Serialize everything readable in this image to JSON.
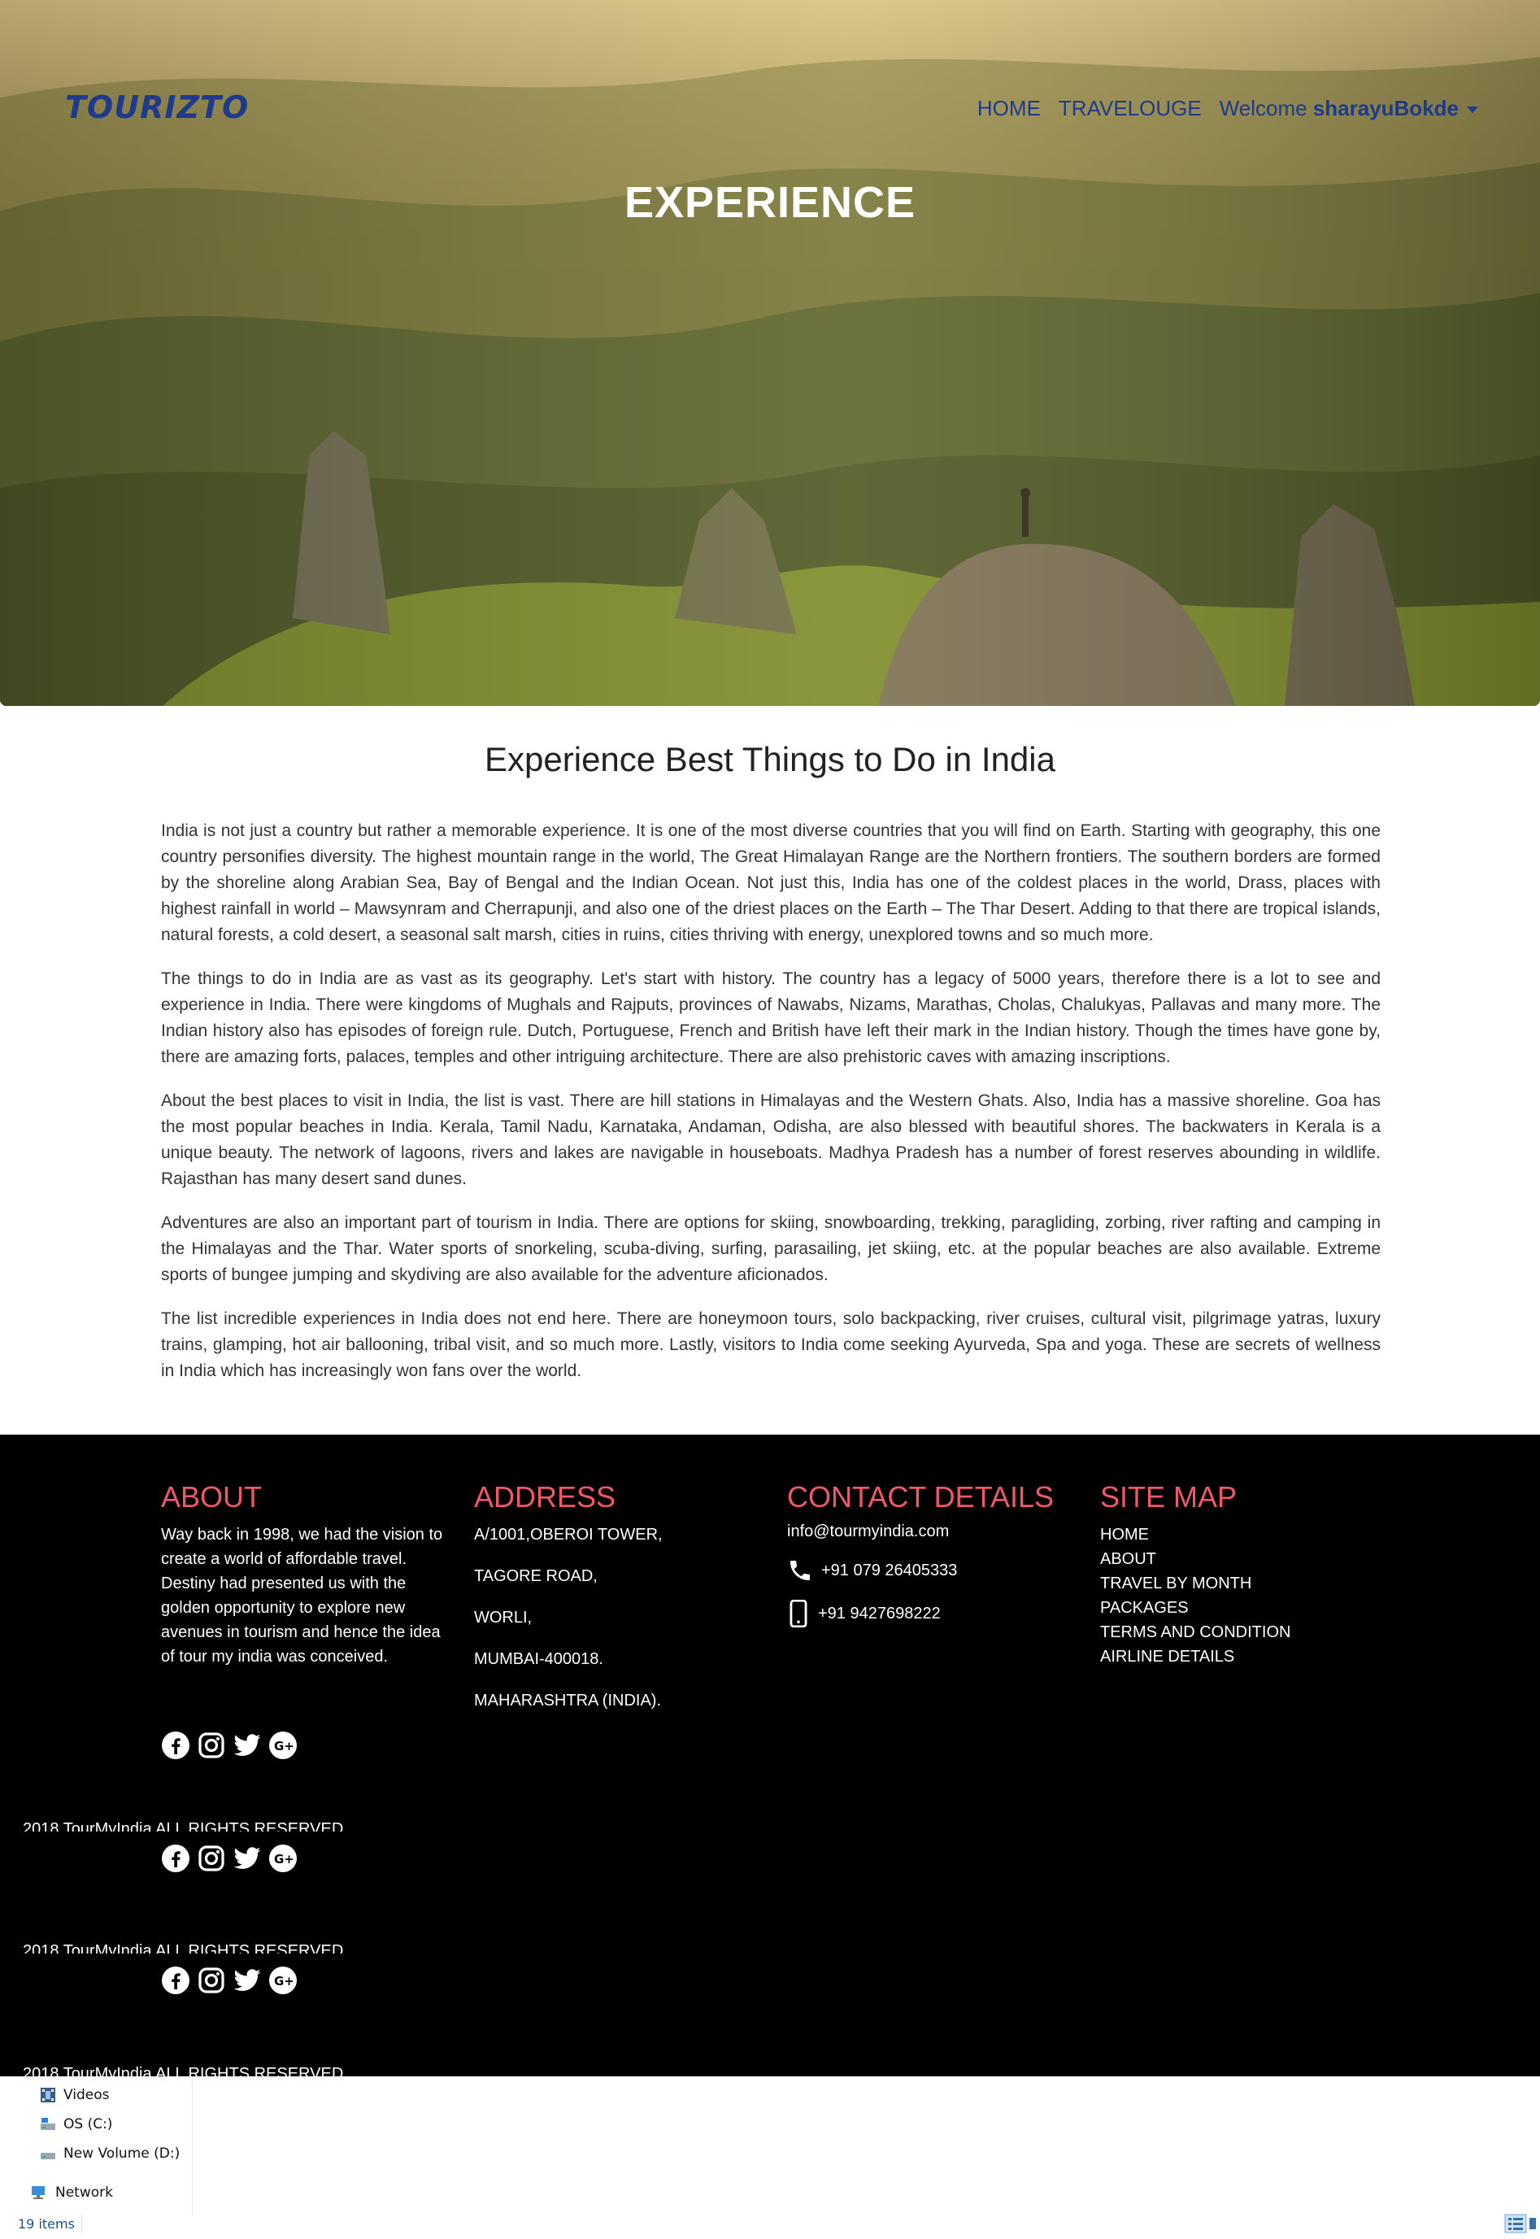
{
  "brand": {
    "logo": "TOURIZTO"
  },
  "nav": {
    "home": "HOME",
    "travelouge": "TRAVELOUGE",
    "welcome": "Welcome",
    "user": "sharayuBokde"
  },
  "hero": {
    "title": "EXPERIENCE"
  },
  "content": {
    "title": "Experience Best Things to Do in India",
    "paragraphs": [
      "India is not just a country but rather a memorable experience. It is one of the most diverse countries that you will find on Earth. Starting with geography, this one country personifies diversity. The highest mountain range in the world, The Great Himalayan Range are the Northern frontiers. The southern borders are formed by the shoreline along Arabian Sea, Bay of Bengal and the Indian Ocean. Not just this, India has one of the coldest places in the world, Drass, places with highest rainfall in world – Mawsynram and Cherrapunji, and also one of the driest places on the Earth – The Thar Desert. Adding to that there are tropical islands, natural forests, a cold desert, a seasonal salt marsh, cities in ruins, cities thriving with energy, unexplored towns and so much more.",
      "The things to do in India are as vast as its geography. Let's start with history. The country has a legacy of 5000 years, therefore there is a lot to see and experience in India. There were kingdoms of Mughals and Rajputs, provinces of Nawabs, Nizams, Marathas, Cholas, Chalukyas, Pallavas and many more. The Indian history also has episodes of foreign rule. Dutch, Portuguese, French and British have left their mark in the Indian history. Though the times have gone by, there are amazing forts, palaces, temples and other intriguing architecture. There are also prehistoric caves with amazing inscriptions.",
      "About the best places to visit in India, the list is vast. There are hill stations in Himalayas and the Western Ghats. Also, India has a massive shoreline. Goa has the most popular beaches in India. Kerala, Tamil Nadu, Karnataka, Andaman, Odisha, are also blessed with beautiful shores. The backwaters in Kerala is a unique beauty. The network of lagoons, rivers and lakes are navigable in houseboats. Madhya Pradesh has a number of forest reserves abounding in wildlife. Rajasthan has many desert sand dunes.",
      "Adventures are also an important part of tourism in India. There are options for skiing, snowboarding, trekking, paragliding, zorbing, river rafting and camping in the Himalayas and the Thar. Water sports of snorkeling, scuba-diving, surfing, parasailing, jet skiing, etc. at the popular beaches are also available. Extreme sports of bungee jumping and skydiving are also available for the adventure aficionados.",
      "The list incredible experiences in India does not end here. There are honeymoon tours, solo backpacking, river cruises, cultural visit, pilgrimage yatras, luxury trains, glamping, hot air ballooning, tribal visit, and so much more. Lastly, visitors to India come seeking Ayurveda, Spa and yoga. These are secrets of wellness in India which has increasingly won fans over the world."
    ]
  },
  "footer": {
    "about": {
      "heading": "ABOUT",
      "text": "Way back in 1998, we had the vision to create a world of affordable travel. Destiny had presented us with the golden opportunity to explore new avenues in tourism and hence the idea of tour my india was conceived."
    },
    "address": {
      "heading": "ADDRESS",
      "lines": [
        "A/1001,OBEROI TOWER,",
        "TAGORE ROAD,",
        "WORLI,",
        "MUMBAI-400018.",
        "MAHARASHTRA (INDIA)."
      ]
    },
    "contact": {
      "heading": "CONTACT DETAILS",
      "email": "info@tourmyindia.com",
      "phone": "+91 079 26405333",
      "mobile": "+91 9427698222"
    },
    "sitemap": {
      "heading": "SITE MAP",
      "links": [
        "HOME",
        "ABOUT",
        "TRAVEL BY MONTH",
        "PACKAGES",
        "TERMS AND CONDITION",
        "AIRLINE DETAILS"
      ]
    },
    "copyright": "2018 TourMyIndia ALL RIGHTS RESERVED",
    "social_icons": [
      "facebook-icon",
      "instagram-icon",
      "twitter-icon",
      "google-plus-icon"
    ]
  },
  "explorer": {
    "items": [
      {
        "label": "Videos",
        "icon": "videos-folder-icon"
      },
      {
        "label": "OS (C:)",
        "icon": "drive-icon"
      },
      {
        "label": "New Volume (D:)",
        "icon": "drive-icon"
      },
      {
        "label": "Network",
        "icon": "network-icon"
      }
    ],
    "status": "19 items"
  },
  "colors": {
    "accent": "#ef5868",
    "nav": "#1e3a8a",
    "footer_bg": "#000000"
  }
}
